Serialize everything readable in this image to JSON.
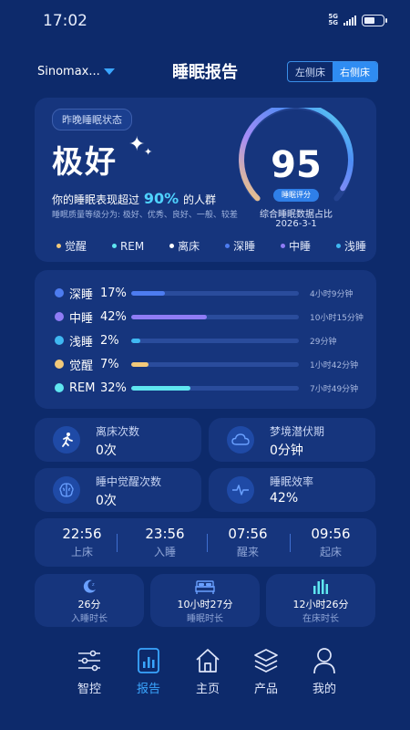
{
  "status_bar": {
    "time": "17:02",
    "network_top": "5G",
    "network_bottom": "5G",
    "battery_level": 0.6
  },
  "header": {
    "device": "Sinomax...",
    "title": "睡眠报告",
    "sides": [
      "左侧床",
      "右侧床"
    ],
    "active_side": "右侧床"
  },
  "summary": {
    "chip": "昨晚睡眠状态",
    "rating": "极好",
    "beat_prefix": "你的睡眠表现超过",
    "beat_percent": "90%",
    "beat_suffix": "的人群",
    "levels_text": "睡眠质量等级分为: 极好、优秀、良好、一般、较差",
    "score": "95",
    "score_badge": "睡眠评分",
    "score_caption": "综合睡眠数据占比",
    "date": "2026-3-1",
    "score_fraction": 0.95
  },
  "legend": [
    {
      "label": "觉醒",
      "color": "#f2c97a"
    },
    {
      "label": "REM",
      "color": "#5fe6f0"
    },
    {
      "label": "离床",
      "color": "#ffffff"
    },
    {
      "label": "深睡",
      "color": "#4d7cf0"
    },
    {
      "label": "中睡",
      "color": "#8f7cf5"
    },
    {
      "label": "浅睡",
      "color": "#3fb8f2"
    }
  ],
  "stages": [
    {
      "name": "深睡",
      "percent": "17%",
      "fraction": 0.17,
      "duration": "4小时9分钟",
      "color": "#4d7cf0"
    },
    {
      "name": "中睡",
      "percent": "42%",
      "fraction": 0.42,
      "duration": "10小时15分钟",
      "color": "#8f7cf5"
    },
    {
      "name": "浅睡",
      "percent": "2%",
      "fraction": 0.02,
      "duration": "29分钟",
      "color": "#3fb8f2"
    },
    {
      "name": "觉醒",
      "percent": "7%",
      "fraction": 0.07,
      "duration": "1小时42分钟",
      "color": "#f2c97a"
    },
    {
      "name": "REM",
      "percent": "32%",
      "fraction": 0.32,
      "duration": "7小时49分钟",
      "color": "#5fe6f0"
    }
  ],
  "metrics": [
    {
      "label": "离床次数",
      "value": "0次",
      "icon": "person-leaving-icon"
    },
    {
      "label": "梦境潜伏期",
      "value": "0分钟",
      "icon": "cloud-icon"
    },
    {
      "label": "睡中觉醒次数",
      "value": "0次",
      "icon": "brain-icon"
    },
    {
      "label": "睡眠效率",
      "value": "42%",
      "icon": "pulse-icon"
    }
  ],
  "times": [
    {
      "value": "22:56",
      "label": "上床"
    },
    {
      "value": "23:56",
      "label": "入睡"
    },
    {
      "value": "07:56",
      "label": "醒来"
    },
    {
      "value": "09:56",
      "label": "起床"
    }
  ],
  "durations": [
    {
      "value": "26分",
      "label": "入睡时长",
      "icon": "moon-icon"
    },
    {
      "value": "10小时27分",
      "label": "睡眠时长",
      "icon": "bed-icon"
    },
    {
      "value": "12小时26分",
      "label": "在床时长",
      "icon": "bar-chart-icon"
    }
  ],
  "nav": [
    {
      "label": "智控",
      "icon": "sliders-icon"
    },
    {
      "label": "报告",
      "icon": "report-icon"
    },
    {
      "label": "主页",
      "icon": "home-icon"
    },
    {
      "label": "产品",
      "icon": "layers-icon"
    },
    {
      "label": "我的",
      "icon": "user-icon"
    }
  ],
  "nav_active": "报告",
  "colors": {
    "background": "#0d2a6b",
    "card": "#16357d",
    "accent": "#3aa6ff"
  }
}
